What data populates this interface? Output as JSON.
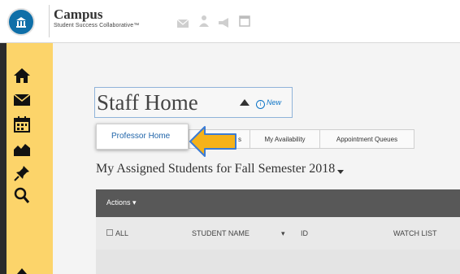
{
  "brand": {
    "title": "Campus",
    "subtitle": "Student Success Collaborative™"
  },
  "page": {
    "title": "Staff Home",
    "new_badge": "New"
  },
  "tabs": {
    "items": [
      "s",
      "My Availability",
      "Appointment Queues"
    ]
  },
  "dropdown": {
    "selected": "Professor Home"
  },
  "section": {
    "title": "My Assigned Students for Fall Semester 2018"
  },
  "table": {
    "actions_label": "Actions",
    "columns": [
      "ALL",
      "STUDENT NAME",
      "ID",
      "WATCH LIST"
    ]
  },
  "colors": {
    "sidebar": "#fcd46a",
    "accent_blue": "#0f6fa8",
    "arrow": "#f5b21a",
    "arrow_outline": "#3a7bd5"
  },
  "icons": {
    "sidebar": [
      "home-icon",
      "mail-icon",
      "calendar-icon",
      "trend-chart-icon",
      "pin-icon",
      "search-icon"
    ],
    "topbar": [
      "mail-icon",
      "person-icon",
      "megaphone-icon",
      "window-icon"
    ]
  }
}
